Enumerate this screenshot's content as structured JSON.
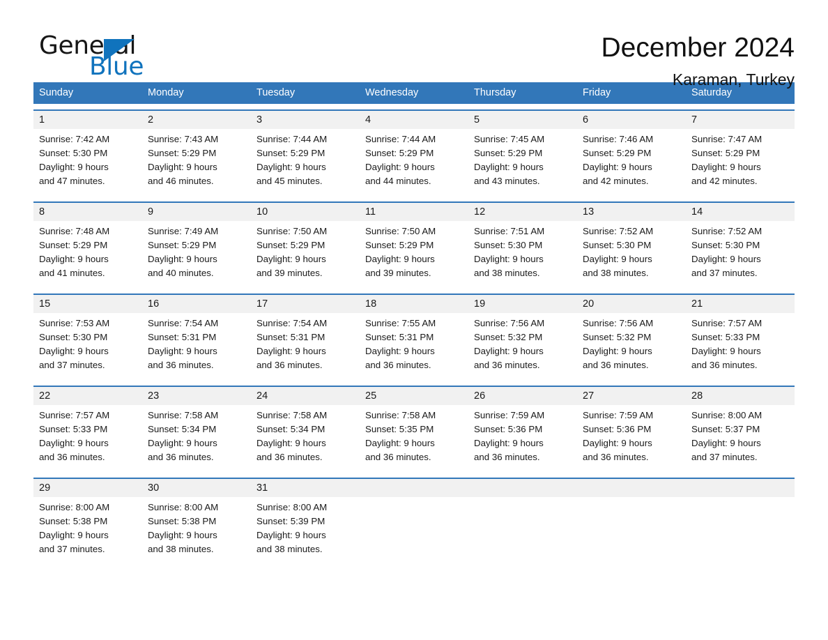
{
  "brand": {
    "word_one": "General",
    "word_two": "Blue",
    "triangle_color": "#1073bd",
    "text_color": "#161616"
  },
  "header": {
    "title": "December 2024",
    "subtitle": "Karaman, Turkey"
  },
  "theme": {
    "header_blue": "#3277b9",
    "daynum_band": "#f1f1f1",
    "text": "#1a1a1a"
  },
  "weekday_headers": [
    "Sunday",
    "Monday",
    "Tuesday",
    "Wednesday",
    "Thursday",
    "Friday",
    "Saturday"
  ],
  "weeks": [
    [
      {
        "day": "1",
        "sunrise": "Sunrise: 7:42 AM",
        "sunset": "Sunset: 5:30 PM",
        "daylight1": "Daylight: 9 hours",
        "daylight2": "and 47 minutes."
      },
      {
        "day": "2",
        "sunrise": "Sunrise: 7:43 AM",
        "sunset": "Sunset: 5:29 PM",
        "daylight1": "Daylight: 9 hours",
        "daylight2": "and 46 minutes."
      },
      {
        "day": "3",
        "sunrise": "Sunrise: 7:44 AM",
        "sunset": "Sunset: 5:29 PM",
        "daylight1": "Daylight: 9 hours",
        "daylight2": "and 45 minutes."
      },
      {
        "day": "4",
        "sunrise": "Sunrise: 7:44 AM",
        "sunset": "Sunset: 5:29 PM",
        "daylight1": "Daylight: 9 hours",
        "daylight2": "and 44 minutes."
      },
      {
        "day": "5",
        "sunrise": "Sunrise: 7:45 AM",
        "sunset": "Sunset: 5:29 PM",
        "daylight1": "Daylight: 9 hours",
        "daylight2": "and 43 minutes."
      },
      {
        "day": "6",
        "sunrise": "Sunrise: 7:46 AM",
        "sunset": "Sunset: 5:29 PM",
        "daylight1": "Daylight: 9 hours",
        "daylight2": "and 42 minutes."
      },
      {
        "day": "7",
        "sunrise": "Sunrise: 7:47 AM",
        "sunset": "Sunset: 5:29 PM",
        "daylight1": "Daylight: 9 hours",
        "daylight2": "and 42 minutes."
      }
    ],
    [
      {
        "day": "8",
        "sunrise": "Sunrise: 7:48 AM",
        "sunset": "Sunset: 5:29 PM",
        "daylight1": "Daylight: 9 hours",
        "daylight2": "and 41 minutes."
      },
      {
        "day": "9",
        "sunrise": "Sunrise: 7:49 AM",
        "sunset": "Sunset: 5:29 PM",
        "daylight1": "Daylight: 9 hours",
        "daylight2": "and 40 minutes."
      },
      {
        "day": "10",
        "sunrise": "Sunrise: 7:50 AM",
        "sunset": "Sunset: 5:29 PM",
        "daylight1": "Daylight: 9 hours",
        "daylight2": "and 39 minutes."
      },
      {
        "day": "11",
        "sunrise": "Sunrise: 7:50 AM",
        "sunset": "Sunset: 5:29 PM",
        "daylight1": "Daylight: 9 hours",
        "daylight2": "and 39 minutes."
      },
      {
        "day": "12",
        "sunrise": "Sunrise: 7:51 AM",
        "sunset": "Sunset: 5:30 PM",
        "daylight1": "Daylight: 9 hours",
        "daylight2": "and 38 minutes."
      },
      {
        "day": "13",
        "sunrise": "Sunrise: 7:52 AM",
        "sunset": "Sunset: 5:30 PM",
        "daylight1": "Daylight: 9 hours",
        "daylight2": "and 38 minutes."
      },
      {
        "day": "14",
        "sunrise": "Sunrise: 7:52 AM",
        "sunset": "Sunset: 5:30 PM",
        "daylight1": "Daylight: 9 hours",
        "daylight2": "and 37 minutes."
      }
    ],
    [
      {
        "day": "15",
        "sunrise": "Sunrise: 7:53 AM",
        "sunset": "Sunset: 5:30 PM",
        "daylight1": "Daylight: 9 hours",
        "daylight2": "and 37 minutes."
      },
      {
        "day": "16",
        "sunrise": "Sunrise: 7:54 AM",
        "sunset": "Sunset: 5:31 PM",
        "daylight1": "Daylight: 9 hours",
        "daylight2": "and 36 minutes."
      },
      {
        "day": "17",
        "sunrise": "Sunrise: 7:54 AM",
        "sunset": "Sunset: 5:31 PM",
        "daylight1": "Daylight: 9 hours",
        "daylight2": "and 36 minutes."
      },
      {
        "day": "18",
        "sunrise": "Sunrise: 7:55 AM",
        "sunset": "Sunset: 5:31 PM",
        "daylight1": "Daylight: 9 hours",
        "daylight2": "and 36 minutes."
      },
      {
        "day": "19",
        "sunrise": "Sunrise: 7:56 AM",
        "sunset": "Sunset: 5:32 PM",
        "daylight1": "Daylight: 9 hours",
        "daylight2": "and 36 minutes."
      },
      {
        "day": "20",
        "sunrise": "Sunrise: 7:56 AM",
        "sunset": "Sunset: 5:32 PM",
        "daylight1": "Daylight: 9 hours",
        "daylight2": "and 36 minutes."
      },
      {
        "day": "21",
        "sunrise": "Sunrise: 7:57 AM",
        "sunset": "Sunset: 5:33 PM",
        "daylight1": "Daylight: 9 hours",
        "daylight2": "and 36 minutes."
      }
    ],
    [
      {
        "day": "22",
        "sunrise": "Sunrise: 7:57 AM",
        "sunset": "Sunset: 5:33 PM",
        "daylight1": "Daylight: 9 hours",
        "daylight2": "and 36 minutes."
      },
      {
        "day": "23",
        "sunrise": "Sunrise: 7:58 AM",
        "sunset": "Sunset: 5:34 PM",
        "daylight1": "Daylight: 9 hours",
        "daylight2": "and 36 minutes."
      },
      {
        "day": "24",
        "sunrise": "Sunrise: 7:58 AM",
        "sunset": "Sunset: 5:34 PM",
        "daylight1": "Daylight: 9 hours",
        "daylight2": "and 36 minutes."
      },
      {
        "day": "25",
        "sunrise": "Sunrise: 7:58 AM",
        "sunset": "Sunset: 5:35 PM",
        "daylight1": "Daylight: 9 hours",
        "daylight2": "and 36 minutes."
      },
      {
        "day": "26",
        "sunrise": "Sunrise: 7:59 AM",
        "sunset": "Sunset: 5:36 PM",
        "daylight1": "Daylight: 9 hours",
        "daylight2": "and 36 minutes."
      },
      {
        "day": "27",
        "sunrise": "Sunrise: 7:59 AM",
        "sunset": "Sunset: 5:36 PM",
        "daylight1": "Daylight: 9 hours",
        "daylight2": "and 36 minutes."
      },
      {
        "day": "28",
        "sunrise": "Sunrise: 8:00 AM",
        "sunset": "Sunset: 5:37 PM",
        "daylight1": "Daylight: 9 hours",
        "daylight2": "and 37 minutes."
      }
    ],
    [
      {
        "day": "29",
        "sunrise": "Sunrise: 8:00 AM",
        "sunset": "Sunset: 5:38 PM",
        "daylight1": "Daylight: 9 hours",
        "daylight2": "and 37 minutes."
      },
      {
        "day": "30",
        "sunrise": "Sunrise: 8:00 AM",
        "sunset": "Sunset: 5:38 PM",
        "daylight1": "Daylight: 9 hours",
        "daylight2": "and 38 minutes."
      },
      {
        "day": "31",
        "sunrise": "Sunrise: 8:00 AM",
        "sunset": "Sunset: 5:39 PM",
        "daylight1": "Daylight: 9 hours",
        "daylight2": "and 38 minutes."
      },
      {
        "day": "",
        "sunrise": "",
        "sunset": "",
        "daylight1": "",
        "daylight2": ""
      },
      {
        "day": "",
        "sunrise": "",
        "sunset": "",
        "daylight1": "",
        "daylight2": ""
      },
      {
        "day": "",
        "sunrise": "",
        "sunset": "",
        "daylight1": "",
        "daylight2": ""
      },
      {
        "day": "",
        "sunrise": "",
        "sunset": "",
        "daylight1": "",
        "daylight2": ""
      }
    ]
  ]
}
